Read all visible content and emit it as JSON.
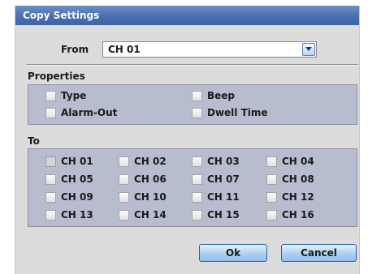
{
  "dialog": {
    "title": "Copy Settings",
    "from": {
      "label": "From",
      "value": "CH 01"
    },
    "properties": {
      "title": "Properties",
      "items": [
        {
          "label": "Type",
          "checked": false
        },
        {
          "label": "Beep",
          "checked": false
        },
        {
          "label": "Alarm-Out",
          "checked": false
        },
        {
          "label": "Dwell Time",
          "checked": false
        }
      ]
    },
    "to": {
      "title": "To",
      "channels": [
        "CH 01",
        "CH 02",
        "CH 03",
        "CH 04",
        "CH 05",
        "CH 06",
        "CH 07",
        "CH 08",
        "CH 09",
        "CH 10",
        "CH 11",
        "CH 12",
        "CH 13",
        "CH 14",
        "CH 15",
        "CH 16"
      ]
    },
    "buttons": {
      "ok": "Ok",
      "cancel": "Cancel"
    }
  },
  "icons": {
    "dropdown": "chevron-down-icon"
  },
  "colors": {
    "title_bar": "#4a6fae",
    "group_bg": "#b8bccf",
    "dialog_bg": "#dcdcdc"
  }
}
